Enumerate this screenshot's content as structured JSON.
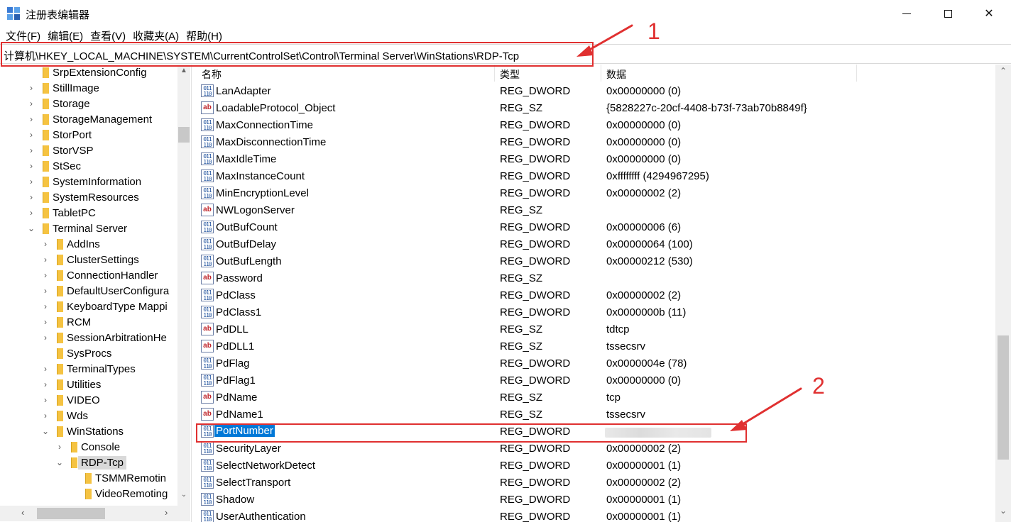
{
  "window": {
    "title": "注册表编辑器",
    "controls": {
      "minimize": "",
      "maximize": "",
      "close": "✕"
    }
  },
  "menu": [
    "文件(F)",
    "编辑(E)",
    "查看(V)",
    "收藏夹(A)",
    "帮助(H)"
  ],
  "address": "计算机\\HKEY_LOCAL_MACHINE\\SYSTEM\\CurrentControlSet\\Control\\Terminal Server\\WinStations\\RDP-Tcp",
  "tree": [
    {
      "label": "SrpExtensionConfig",
      "depth": 0,
      "chevron": ""
    },
    {
      "label": "StillImage",
      "depth": 0,
      "chevron": "›"
    },
    {
      "label": "Storage",
      "depth": 0,
      "chevron": "›"
    },
    {
      "label": "StorageManagement",
      "depth": 0,
      "chevron": "›"
    },
    {
      "label": "StorPort",
      "depth": 0,
      "chevron": "›"
    },
    {
      "label": "StorVSP",
      "depth": 0,
      "chevron": "›"
    },
    {
      "label": "StSec",
      "depth": 0,
      "chevron": "›"
    },
    {
      "label": "SystemInformation",
      "depth": 0,
      "chevron": "›"
    },
    {
      "label": "SystemResources",
      "depth": 0,
      "chevron": "›"
    },
    {
      "label": "TabletPC",
      "depth": 0,
      "chevron": "›"
    },
    {
      "label": "Terminal Server",
      "depth": 0,
      "chevron": "⌄"
    },
    {
      "label": "AddIns",
      "depth": 1,
      "chevron": "›"
    },
    {
      "label": "ClusterSettings",
      "depth": 1,
      "chevron": "›"
    },
    {
      "label": "ConnectionHandler",
      "depth": 1,
      "chevron": "›"
    },
    {
      "label": "DefaultUserConfigura",
      "depth": 1,
      "chevron": "›"
    },
    {
      "label": "KeyboardType Mappi",
      "depth": 1,
      "chevron": "›"
    },
    {
      "label": "RCM",
      "depth": 1,
      "chevron": "›"
    },
    {
      "label": "SessionArbitrationHe",
      "depth": 1,
      "chevron": "›"
    },
    {
      "label": "SysProcs",
      "depth": 1,
      "chevron": ""
    },
    {
      "label": "TerminalTypes",
      "depth": 1,
      "chevron": "›"
    },
    {
      "label": "Utilities",
      "depth": 1,
      "chevron": "›"
    },
    {
      "label": "VIDEO",
      "depth": 1,
      "chevron": "›"
    },
    {
      "label": "Wds",
      "depth": 1,
      "chevron": "›"
    },
    {
      "label": "WinStations",
      "depth": 1,
      "chevron": "⌄"
    },
    {
      "label": "Console",
      "depth": 2,
      "chevron": "›"
    },
    {
      "label": "RDP-Tcp",
      "depth": 2,
      "chevron": "⌄",
      "selected": true
    },
    {
      "label": "TSMMRemotin",
      "depth": 3,
      "chevron": ""
    },
    {
      "label": "VideoRemoting",
      "depth": 3,
      "chevron": ""
    }
  ],
  "list": {
    "headers": {
      "name": "名称",
      "type": "类型",
      "data": "数据"
    },
    "rows": [
      {
        "name": "LanAdapter",
        "type": "REG_DWORD",
        "data": "0x00000000 (0)",
        "icon": "bin"
      },
      {
        "name": "LoadableProtocol_Object",
        "type": "REG_SZ",
        "data": "{5828227c-20cf-4408-b73f-73ab70b8849f}",
        "icon": "sz"
      },
      {
        "name": "MaxConnectionTime",
        "type": "REG_DWORD",
        "data": "0x00000000 (0)",
        "icon": "bin"
      },
      {
        "name": "MaxDisconnectionTime",
        "type": "REG_DWORD",
        "data": "0x00000000 (0)",
        "icon": "bin"
      },
      {
        "name": "MaxIdleTime",
        "type": "REG_DWORD",
        "data": "0x00000000 (0)",
        "icon": "bin"
      },
      {
        "name": "MaxInstanceCount",
        "type": "REG_DWORD",
        "data": "0xffffffff (4294967295)",
        "icon": "bin"
      },
      {
        "name": "MinEncryptionLevel",
        "type": "REG_DWORD",
        "data": "0x00000002 (2)",
        "icon": "bin"
      },
      {
        "name": "NWLogonServer",
        "type": "REG_SZ",
        "data": "",
        "icon": "sz"
      },
      {
        "name": "OutBufCount",
        "type": "REG_DWORD",
        "data": "0x00000006 (6)",
        "icon": "bin"
      },
      {
        "name": "OutBufDelay",
        "type": "REG_DWORD",
        "data": "0x00000064 (100)",
        "icon": "bin"
      },
      {
        "name": "OutBufLength",
        "type": "REG_DWORD",
        "data": "0x00000212 (530)",
        "icon": "bin"
      },
      {
        "name": "Password",
        "type": "REG_SZ",
        "data": "",
        "icon": "sz"
      },
      {
        "name": "PdClass",
        "type": "REG_DWORD",
        "data": "0x00000002 (2)",
        "icon": "bin"
      },
      {
        "name": "PdClass1",
        "type": "REG_DWORD",
        "data": "0x0000000b (11)",
        "icon": "bin"
      },
      {
        "name": "PdDLL",
        "type": "REG_SZ",
        "data": "tdtcp",
        "icon": "sz"
      },
      {
        "name": "PdDLL1",
        "type": "REG_SZ",
        "data": "tssecsrv",
        "icon": "sz"
      },
      {
        "name": "PdFlag",
        "type": "REG_DWORD",
        "data": "0x0000004e (78)",
        "icon": "bin"
      },
      {
        "name": "PdFlag1",
        "type": "REG_DWORD",
        "data": "0x00000000 (0)",
        "icon": "bin"
      },
      {
        "name": "PdName",
        "type": "REG_SZ",
        "data": "tcp",
        "icon": "sz"
      },
      {
        "name": "PdName1",
        "type": "REG_SZ",
        "data": "tssecsrv",
        "icon": "sz"
      },
      {
        "name": "PortNumber",
        "type": "REG_DWORD",
        "data": "",
        "icon": "bin",
        "selected": true,
        "blurred": true
      },
      {
        "name": "SecurityLayer",
        "type": "REG_DWORD",
        "data": "0x00000002 (2)",
        "icon": "bin"
      },
      {
        "name": "SelectNetworkDetect",
        "type": "REG_DWORD",
        "data": "0x00000001 (1)",
        "icon": "bin"
      },
      {
        "name": "SelectTransport",
        "type": "REG_DWORD",
        "data": "0x00000002 (2)",
        "icon": "bin"
      },
      {
        "name": "Shadow",
        "type": "REG_DWORD",
        "data": "0x00000001 (1)",
        "icon": "bin"
      },
      {
        "name": "UserAuthentication",
        "type": "REG_DWORD",
        "data": "0x00000001 (1)",
        "icon": "bin"
      }
    ]
  },
  "annotations": {
    "label_1": "1",
    "label_2": "2",
    "color": "#e03030"
  },
  "colors": {
    "selection": "#0078d7",
    "folder": "#f5c342",
    "annotation": "#e03030"
  }
}
